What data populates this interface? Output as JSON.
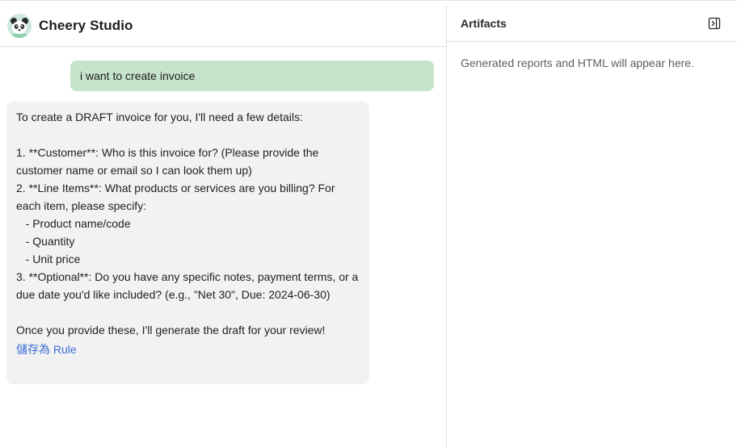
{
  "app": {
    "title": "Cheery Studio",
    "avatar_icon": "panda-icon"
  },
  "chat": {
    "user_message": "i want to create invoice",
    "assistant_message": "To create a DRAFT invoice for you, I'll need a few details:\n\n1. **Customer**: Who is this invoice for? (Please provide the customer name or email so I can look them up)\n2. **Line Items**: What products or services are you billing? For each item, please specify:\n   - Product name/code\n   - Quantity\n   - Unit price\n3. **Optional**: Do you have any specific notes, payment terms, or a due date you'd like included? (e.g., \"Net 30\", Due: 2024-06-30)\n\nOnce you provide these, I'll generate the draft for your review!",
    "save_rule_label": "儲存為 Rule"
  },
  "artifacts": {
    "title": "Artifacts",
    "empty_text": "Generated reports and HTML will appear here.",
    "toggle_icon": "panel-collapse-icon"
  },
  "colors": {
    "user_bubble": "#c6e3cc",
    "assistant_bubble": "#f2f2f2",
    "link": "#3b6fd6",
    "border": "#e3e3e3"
  }
}
